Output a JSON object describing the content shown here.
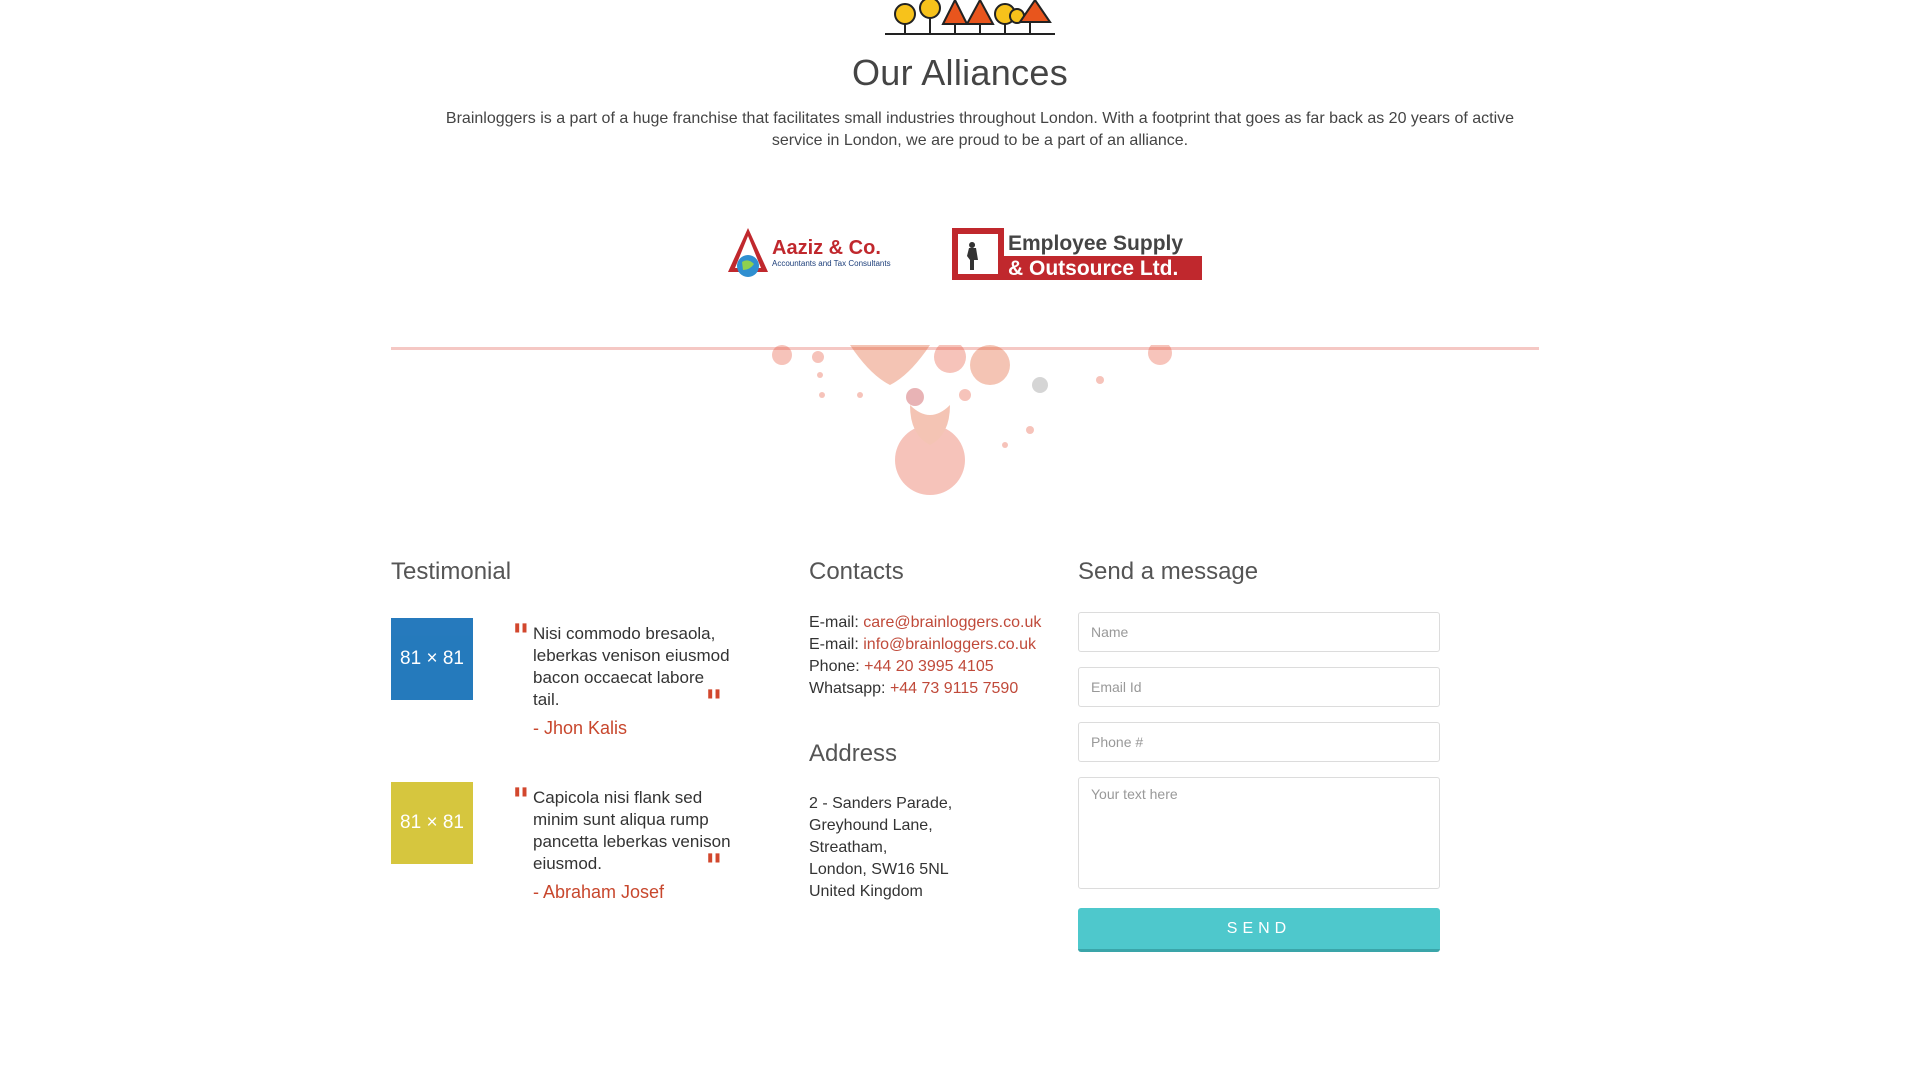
{
  "alliances": {
    "title": "Our Alliances",
    "description": "Brainloggers is a part of a huge franchise that facilitates small industries throughout London. With a footprint that goes as far back as 20 years of active service in London, we are proud to be a part of an alliance.",
    "partners": [
      {
        "name": "Aaziz & Co.",
        "tagline": "Accountants and Tax Consultants"
      },
      {
        "name_line1": "Employee Supply",
        "name_line2": "& Outsource Ltd."
      }
    ]
  },
  "testimonial": {
    "title": "Testimonial",
    "items": [
      {
        "thumb_label": "81 × 81",
        "thumb_color": "#1a73b9",
        "quote": "Nisi commodo bresaola, leberkas venison eiusmod bacon occaecat labore tail.",
        "author": "- Jhon Kalis"
      },
      {
        "thumb_label": "81 × 81",
        "thumb_color": "#d4c434",
        "quote": "Capicola nisi flank sed minim sunt aliqua rump pancetta leberkas venison eiusmod.",
        "author": "- Abraham Josef"
      }
    ]
  },
  "contacts": {
    "title": "Contacts",
    "lines": [
      {
        "label": "E-mail: ",
        "value": "care@brainloggers.co.uk"
      },
      {
        "label": "E-mail: ",
        "value": "info@brainloggers.co.uk"
      },
      {
        "label": "Phone: ",
        "value": "+44 20 3995 4105"
      },
      {
        "label": "Whatsapp: ",
        "value": "+44 73 9115 7590"
      }
    ]
  },
  "address": {
    "title": "Address",
    "lines": [
      "2 - Sanders Parade,",
      "Greyhound Lane,",
      "Streatham,",
      "London, SW16 5NL",
      "United Kingdom"
    ]
  },
  "message_form": {
    "title": "Send a message",
    "name_placeholder": "Name",
    "email_placeholder": "Email Id",
    "phone_placeholder": "Phone #",
    "message_placeholder": "Your text here",
    "send_label": "SEND"
  },
  "colors": {
    "accent": "#4ec8cc",
    "link": "#c04a3a",
    "quote_mark": "#d2472d"
  }
}
